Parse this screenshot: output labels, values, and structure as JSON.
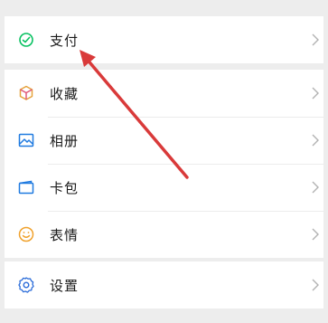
{
  "menu": {
    "groups": [
      {
        "items": [
          {
            "label": "支付",
            "icon": "pay-icon",
            "color": "#07c160"
          }
        ]
      },
      {
        "items": [
          {
            "label": "收藏",
            "icon": "favorites-cube-icon",
            "color": "#e6a23c"
          },
          {
            "label": "相册",
            "icon": "album-picture-icon",
            "color": "#1f7ae0"
          },
          {
            "label": "卡包",
            "icon": "card-wallet-icon",
            "color": "#1f7ae0"
          },
          {
            "label": "表情",
            "icon": "smiley-face-icon",
            "color": "#f0a12b"
          }
        ]
      },
      {
        "items": [
          {
            "label": "设置",
            "icon": "gear-icon",
            "color": "#2b6cd9"
          }
        ]
      }
    ]
  },
  "annotation": {
    "icon": "red-arrow-icon",
    "color": "#d93a3a",
    "target": "支付"
  },
  "theme": {
    "background": "#ededed",
    "surface": "#ffffff",
    "text": "#191919",
    "chevron": "#b2b2b2"
  }
}
